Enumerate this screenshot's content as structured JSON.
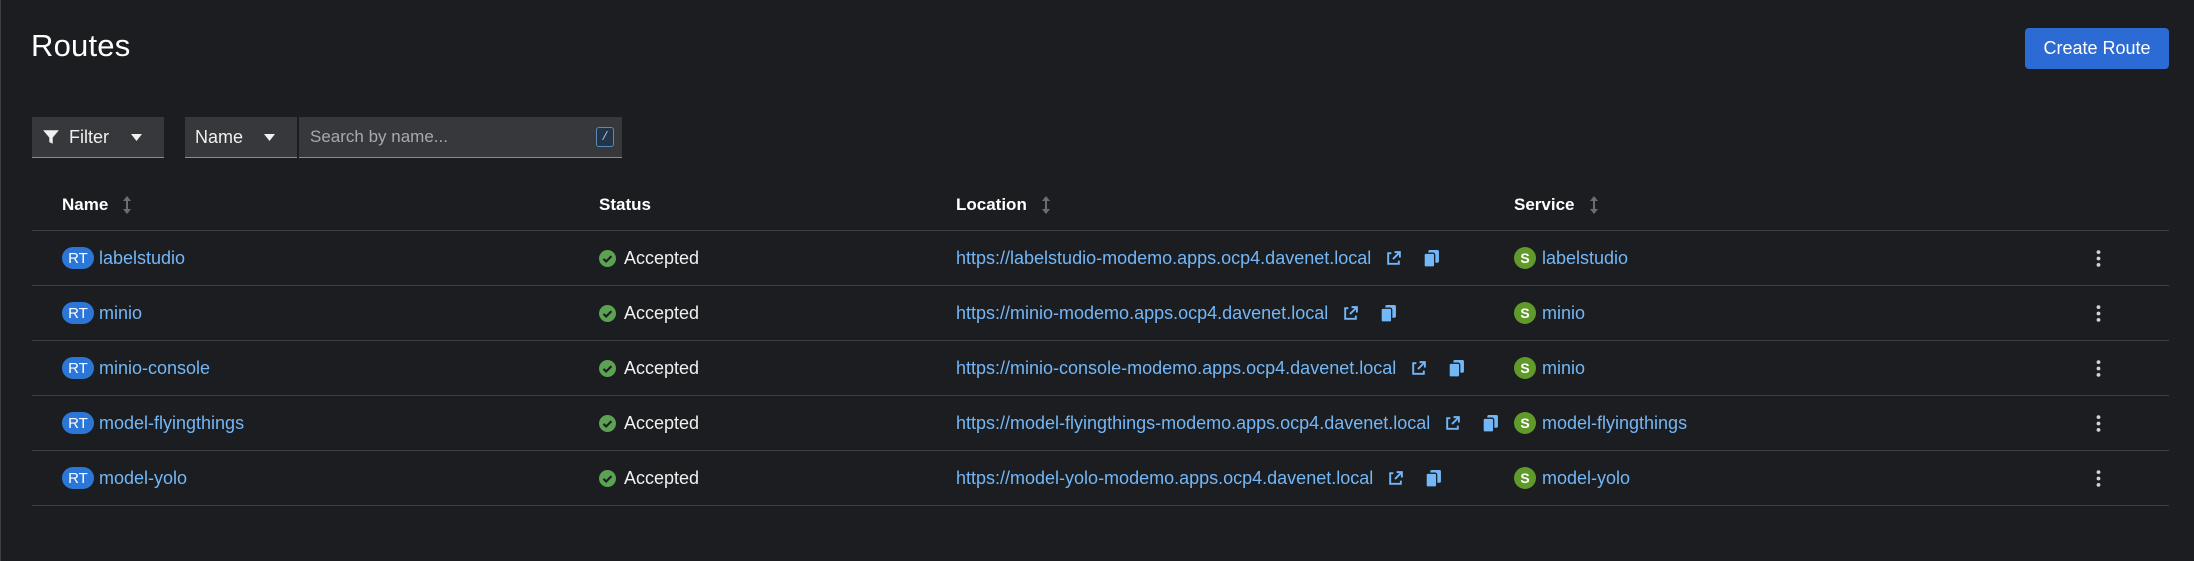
{
  "page": {
    "title": "Routes"
  },
  "toolbar": {
    "create_label": "Create Route",
    "filter_label": "Filter",
    "filter_attr_label": "Name",
    "search_placeholder": "Search by name...",
    "search_value": "",
    "search_shortcut": "/"
  },
  "table": {
    "columns": [
      {
        "label": "Name",
        "sortable": true
      },
      {
        "label": "Status",
        "sortable": false
      },
      {
        "label": "Location",
        "sortable": true
      },
      {
        "label": "Service",
        "sortable": true
      }
    ],
    "rows": [
      {
        "badge": "RT",
        "name": "labelstudio",
        "status": "Accepted",
        "location": "https://labelstudio-modemo.apps.ocp4.davenet.local",
        "service_badge": "S",
        "service": "labelstudio"
      },
      {
        "badge": "RT",
        "name": "minio",
        "status": "Accepted",
        "location": "https://minio-modemo.apps.ocp4.davenet.local",
        "service_badge": "S",
        "service": "minio"
      },
      {
        "badge": "RT",
        "name": "minio-console",
        "status": "Accepted",
        "location": "https://minio-console-modemo.apps.ocp4.davenet.local",
        "service_badge": "S",
        "service": "minio"
      },
      {
        "badge": "RT",
        "name": "model-flyingthings",
        "status": "Accepted",
        "location": "https://model-flyingthings-modemo.apps.ocp4.davenet.local",
        "service_badge": "S",
        "service": "model-flyingthings"
      },
      {
        "badge": "RT",
        "name": "model-yolo",
        "status": "Accepted",
        "location": "https://model-yolo-modemo.apps.ocp4.davenet.local",
        "service_badge": "S",
        "service": "model-yolo"
      }
    ]
  },
  "icons": {
    "filter": "filter-icon",
    "caret": "caret-down-icon",
    "sort": "sort-icon",
    "status_ok": "check-circle-icon",
    "external_link": "external-link-icon",
    "copy": "copy-icon",
    "kebab": "kebab-menu-icon"
  },
  "colors": {
    "background": "#1b1d21",
    "primary_button": "#2c6bd3",
    "link": "#73b7f7",
    "route_badge": "#2b76d6",
    "service_badge": "#5f9a2a",
    "success": "#5ba352"
  }
}
